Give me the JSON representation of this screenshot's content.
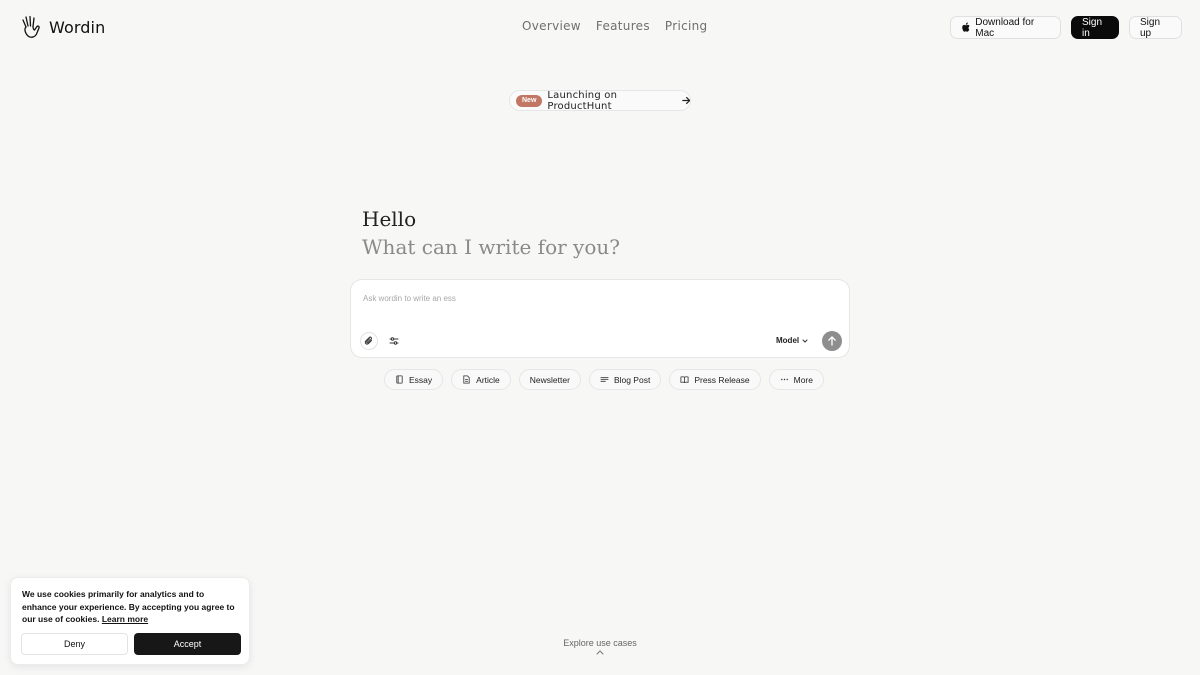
{
  "header": {
    "brand": "Wordin",
    "nav": [
      "Overview",
      "Features",
      "Pricing"
    ],
    "download_label": "Download for Mac",
    "signin_label": "Sign in",
    "signup_label": "Sign up"
  },
  "announcement": {
    "badge": "New",
    "text": "Launching on ProductHunt",
    "icon": "arrow-right-icon"
  },
  "hero": {
    "title": "Hello",
    "subtitle": "What can I write for you?"
  },
  "prompt": {
    "placeholder": "Ask wordin to write an ess",
    "model_label": "Model"
  },
  "chips": [
    {
      "label": "Essay",
      "icon": "book-icon"
    },
    {
      "label": "Article",
      "icon": "document-icon"
    },
    {
      "label": "Newsletter",
      "icon": ""
    },
    {
      "label": "Blog Post",
      "icon": "lines-icon"
    },
    {
      "label": "Press Release",
      "icon": "open-book-icon"
    },
    {
      "label": "More",
      "icon": "ellipsis-icon"
    }
  ],
  "cookie": {
    "text": "We use cookies primarily for analytics and to enhance your experience. By accepting you agree to our use of cookies.",
    "learn_more": "Learn more",
    "deny_label": "Deny",
    "accept_label": "Accept"
  },
  "footer": {
    "explore_label": "Explore use cases"
  },
  "colors": {
    "background": "#f7f7f6",
    "badge": "#c27764",
    "primary_button": "#0a0a0a",
    "send_button": "#8e8e8e"
  }
}
